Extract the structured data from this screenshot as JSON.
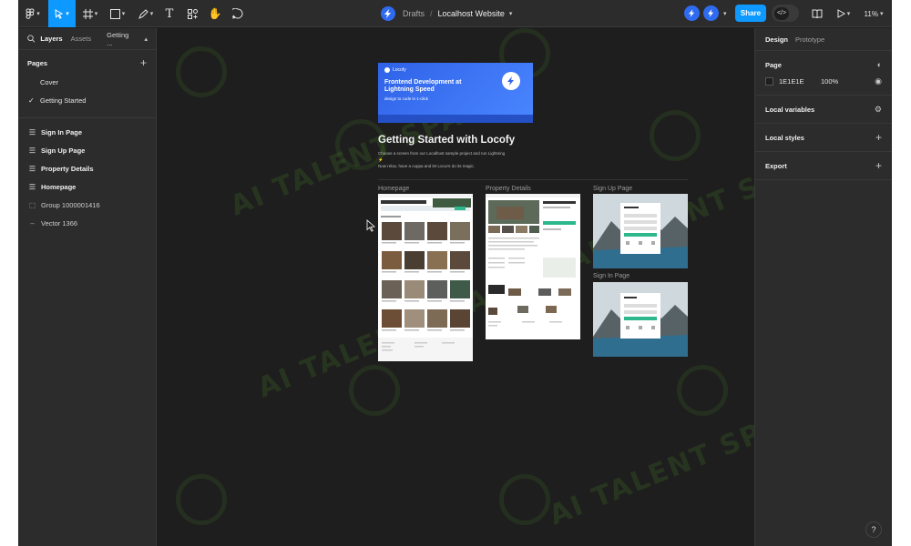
{
  "toolbar": {
    "breadcrumb": {
      "folder": "Drafts",
      "separator": "/",
      "file": "Localhost Website"
    },
    "share_label": "Share",
    "zoom": "11%"
  },
  "left_panel": {
    "tabs": [
      "Layers",
      "Assets",
      "Getting ..."
    ],
    "pages_title": "Pages",
    "pages": [
      {
        "label": "Cover",
        "current": false
      },
      {
        "label": "Getting Started",
        "current": true
      }
    ],
    "layers": [
      {
        "label": "Sign In Page",
        "icon": "frame-icon",
        "bold": true
      },
      {
        "label": "Sign Up Page",
        "icon": "frame-icon",
        "bold": true
      },
      {
        "label": "Property Details",
        "icon": "frame-icon",
        "bold": true
      },
      {
        "label": "Homepage",
        "icon": "frame-icon",
        "bold": true
      },
      {
        "label": "Group 1000001416",
        "icon": "group-icon",
        "bold": false
      },
      {
        "label": "Vector 1366",
        "icon": "vector-icon",
        "bold": false
      }
    ]
  },
  "right_panel": {
    "tabs": [
      "Design",
      "Prototype"
    ],
    "page_title": "Page",
    "bg_hex": "1E1E1E",
    "bg_opacity": "100%",
    "local_variables": "Local variables",
    "local_styles": "Local styles",
    "export": "Export"
  },
  "canvas": {
    "cover": {
      "brand": "Locofy",
      "headline": "Frontend Development at Lightning Speed",
      "chip": "design to code in 1-click"
    },
    "title": "Getting Started with Locofy",
    "description_line1": "Choose a screen from our Localhost sample project and run Lightning ⚡",
    "description_line2": "Now relax, have a cuppa and let LocoAI do its magic.",
    "frames": {
      "homepage": "Homepage",
      "property": "Property Details",
      "signup": "Sign Up Page",
      "signin": "Sign In Page"
    },
    "watermark": "AI TALENT SPACE"
  },
  "colors": {
    "accent": "#0d99ff",
    "locofy_blue": "#2f6bf0",
    "bg": "#1e1e1e",
    "panel": "#2c2c2c"
  },
  "help_label": "?"
}
